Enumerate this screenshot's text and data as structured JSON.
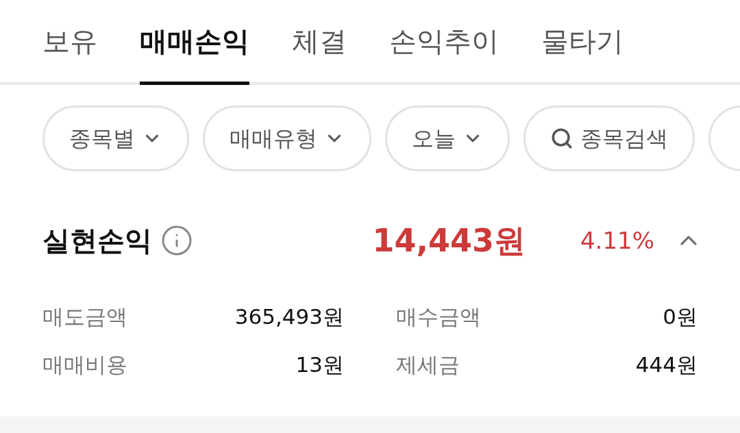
{
  "tabs": [
    {
      "label": "보유",
      "selected": false
    },
    {
      "label": "매매손익",
      "selected": true
    },
    {
      "label": "체결",
      "selected": false
    },
    {
      "label": "손익추이",
      "selected": false
    },
    {
      "label": "물타기",
      "selected": false
    }
  ],
  "filters": [
    {
      "kind": "dropdown",
      "label": "종목별"
    },
    {
      "kind": "dropdown",
      "label": "매매유형"
    },
    {
      "kind": "dropdown",
      "label": "오늘"
    },
    {
      "kind": "search",
      "label": "종목검색"
    }
  ],
  "summary": {
    "title": "실현손익",
    "amount": "14,443원",
    "rate": "4.11%",
    "expanded": true
  },
  "details": [
    {
      "label": "매도금액",
      "value": "365,493원"
    },
    {
      "label": "매수금액",
      "value": "0원"
    },
    {
      "label": "매매비용",
      "value": "13원"
    },
    {
      "label": "제세금",
      "value": "444원"
    }
  ]
}
